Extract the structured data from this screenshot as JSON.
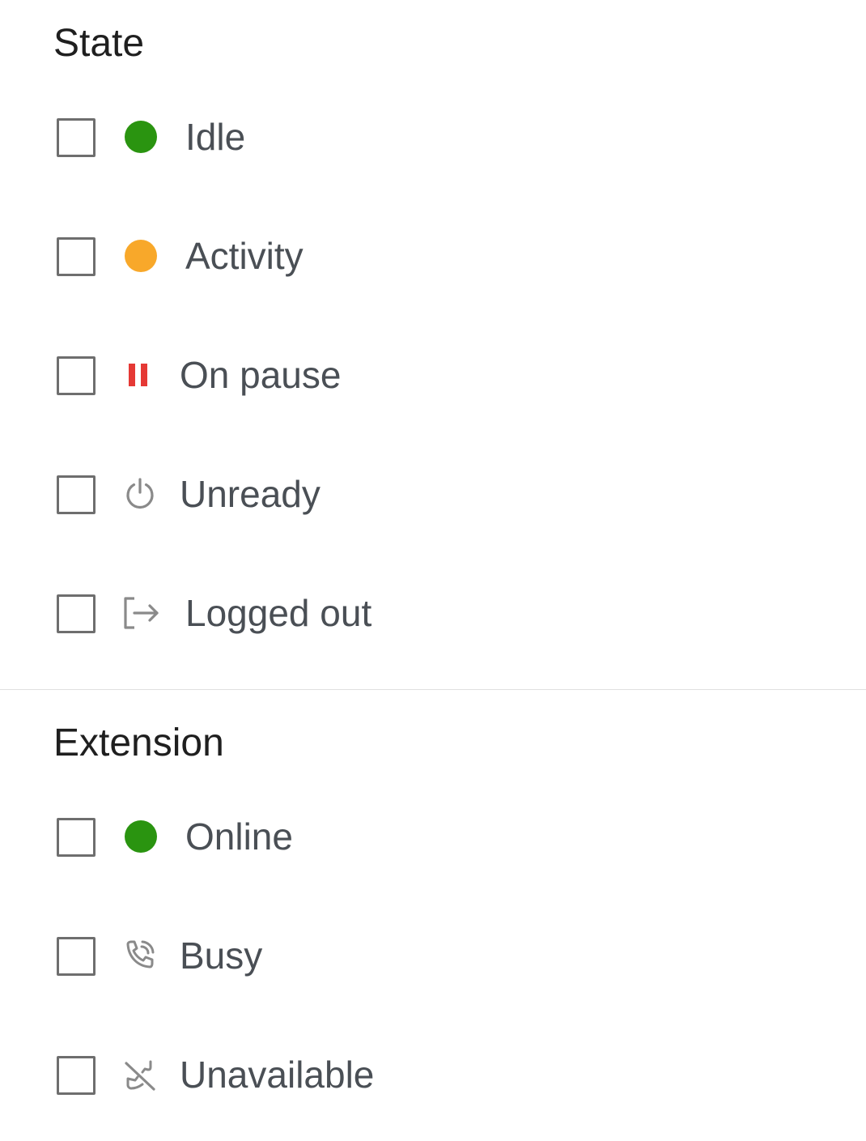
{
  "state": {
    "title": "State",
    "options": [
      {
        "label": "Idle",
        "icon": "green-dot-icon",
        "checked": false
      },
      {
        "label": "Activity",
        "icon": "orange-dot-icon",
        "checked": false
      },
      {
        "label": "On pause",
        "icon": "pause-icon",
        "checked": false
      },
      {
        "label": "Unready",
        "icon": "power-icon",
        "checked": false
      },
      {
        "label": "Logged out",
        "icon": "logout-icon",
        "checked": false
      }
    ]
  },
  "extension": {
    "title": "Extension",
    "options": [
      {
        "label": "Online",
        "icon": "green-dot-icon",
        "checked": false
      },
      {
        "label": "Busy",
        "icon": "phone-in-talk-icon",
        "checked": false
      },
      {
        "label": "Unavailable",
        "icon": "phone-disabled-icon",
        "checked": false
      }
    ]
  },
  "colors": {
    "idle": "#2a9410",
    "activity": "#f8a82a",
    "pause": "#e53935",
    "icon_gray": "#8a8a8a"
  }
}
